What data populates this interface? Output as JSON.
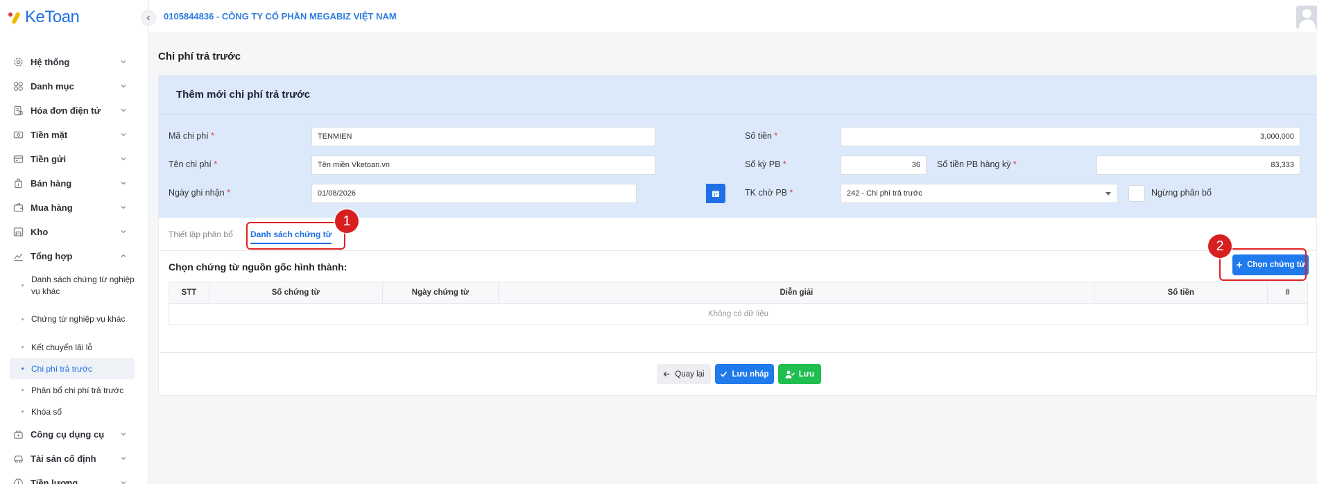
{
  "app": {
    "logo_text": "KeToan"
  },
  "header": {
    "company": "0105844836 - CÔNG TY CỔ PHẦN MEGABIZ VIỆT NAM"
  },
  "sidebar": {
    "items": [
      {
        "label": "Hệ thống",
        "icon": "gear-icon"
      },
      {
        "label": "Danh mục",
        "icon": "grid-icon"
      },
      {
        "label": "Hóa đơn điện tử",
        "icon": "invoice-icon"
      },
      {
        "label": "Tiền mặt",
        "icon": "cash-icon"
      },
      {
        "label": "Tiền gửi",
        "icon": "card-icon"
      },
      {
        "label": "Bán hàng",
        "icon": "bag-icon"
      },
      {
        "label": "Mua hàng",
        "icon": "wallet-icon"
      },
      {
        "label": "Kho",
        "icon": "warehouse-icon"
      },
      {
        "label": "Tổng hợp",
        "icon": "chart-icon"
      }
    ],
    "sub_items": [
      {
        "label": "Danh sách chứng từ nghiệp vụ khác"
      },
      {
        "label": "Chứng từ nghiệp vụ khác"
      },
      {
        "label": "Kết chuyển lãi lỗ"
      },
      {
        "label": "Chi phí trả trước"
      },
      {
        "label": "Phân bổ chi phí trả trước"
      },
      {
        "label": "Khóa sổ"
      }
    ],
    "after_items": [
      {
        "label": "Công cụ dụng cụ",
        "icon": "tools-icon"
      },
      {
        "label": "Tài sản cố định",
        "icon": "car-icon"
      },
      {
        "label": "Tiền lương",
        "icon": "salary-icon"
      }
    ]
  },
  "page": {
    "title": "Chi phí trả trước"
  },
  "form": {
    "title": "Thêm mới chi phí trả trước",
    "ma_chi_phi": {
      "label": "Mã chi phí",
      "value": "TENMIEN"
    },
    "ten_chi_phi": {
      "label": "Tên chi phí",
      "value": "Tên miền Vketoan.vn"
    },
    "ngay_ghi_nhan": {
      "label": "Ngày ghi nhận",
      "value": "01/08/2026"
    },
    "so_tien": {
      "label": "Số tiền",
      "value": "3,000,000"
    },
    "so_ky_pb": {
      "label": "Số kỳ PB",
      "value": "36"
    },
    "so_tien_pb": {
      "label": "Số tiền PB hàng kỳ",
      "value": "83,333"
    },
    "tk_cho_pb": {
      "label": "TK chờ PB",
      "value": "242 - Chi phí trả trước"
    },
    "ngung_phan_bo": {
      "label": "Ngừng phân bổ"
    },
    "required_mark": "*"
  },
  "tabs": [
    {
      "label": "Thiết lập phân bổ"
    },
    {
      "label": "Danh sách chứng từ"
    }
  ],
  "section": {
    "title": "Chọn chứng từ nguồn gốc hình thành:",
    "choose_button": "Chọn chứng từ"
  },
  "table": {
    "columns": [
      "STT",
      "Số chứng từ",
      "Ngày chứng từ",
      "Diễn giải",
      "Số tiền",
      "#"
    ],
    "empty_text": "Không có dữ liệu"
  },
  "buttons": {
    "back": "Quay lại",
    "draft": "Lưu nháp",
    "save": "Lưu"
  },
  "annotations": {
    "marker1": "1",
    "marker2": "2"
  },
  "colors": {
    "primary": "#1f7aec",
    "success": "#1fbf4f",
    "annotation": "#d81f1f",
    "form_bg": "#dbe9fb"
  }
}
